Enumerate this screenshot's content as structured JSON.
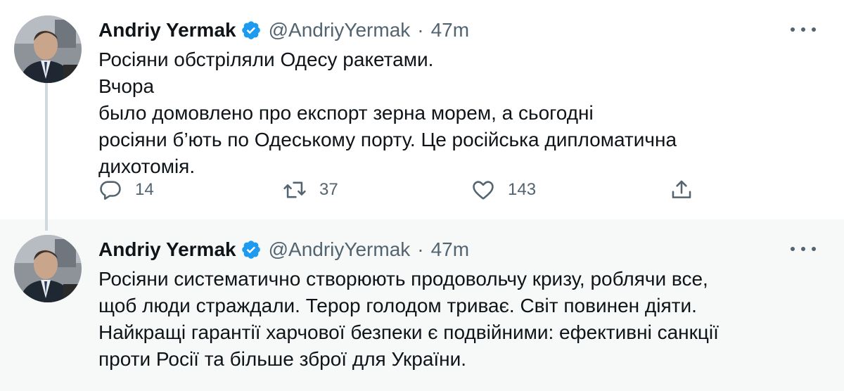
{
  "tweets": [
    {
      "author_name": "Andriy Yermak",
      "handle": "@AndriyYermak",
      "separator": "·",
      "time": "47m",
      "lines": [
        "Росіяни обстріляли Одесу ракетами.",
        "было домовлено про експорт зерна морем, а сьогодні",
        "росіяни б’ють по Одеському порту. Це російська дипломатична",
        "дихотомія."
      ],
      "line2_prefix": "Вчора",
      "flag_icon": "ukraine-flag-icon",
      "reply_count": "14",
      "retweet_count": "37",
      "like_count": "143"
    },
    {
      "author_name": "Andriy Yermak",
      "handle": "@AndriyYermak",
      "separator": "·",
      "time": "47m",
      "lines": [
        "Росіяни систематично створюють продовольчу кризу, роблячи все,",
        "щоб люди страждали. Терор голодом триває. Світ повинен діяти.",
        "Найкращі гарантії харчової безпеки є подвійними: ефективні санкції",
        "проти Росії та більше зброї для України."
      ]
    }
  ],
  "colors": {
    "text": "#0f1419",
    "secondary": "#536471",
    "verified": "#1d9bf0",
    "thread_line": "#cfd9de",
    "reply_bg": "#f7f9f9"
  },
  "icons": [
    "verified-badge-icon",
    "more-options-icon",
    "reply-icon",
    "retweet-icon",
    "like-icon",
    "share-icon"
  ]
}
